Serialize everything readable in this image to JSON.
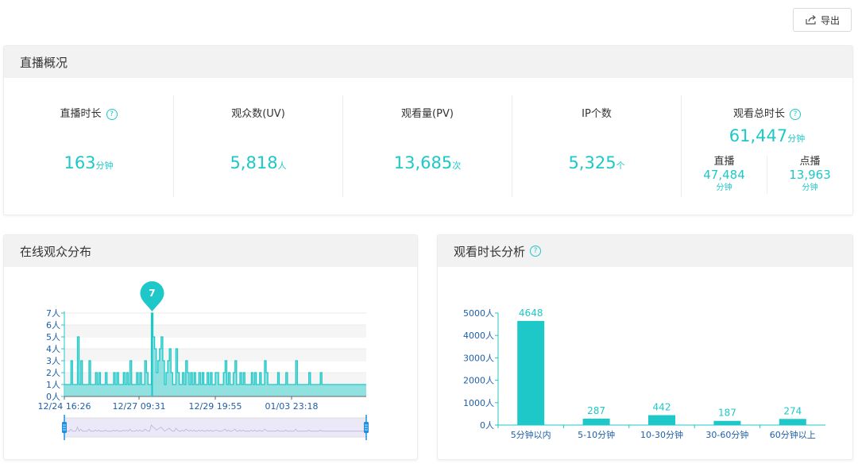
{
  "toolbar": {
    "export_label": "导出",
    "export_icon": "export-icon"
  },
  "overview": {
    "title": "直播概况",
    "stats": [
      {
        "label": "直播时长",
        "value": "163",
        "unit": "分钟",
        "help": true
      },
      {
        "label": "观众数(UV)",
        "value": "5,818",
        "unit": "人",
        "help": false
      },
      {
        "label": "观看量(PV)",
        "value": "13,685",
        "unit": "次",
        "help": false
      },
      {
        "label": "IP个数",
        "value": "5,325",
        "unit": "个",
        "help": false
      }
    ],
    "total": {
      "label": "观看总时长",
      "value": "61,447",
      "unit": "分钟",
      "live": {
        "label": "直播",
        "value": "47,484",
        "unit": "分钟"
      },
      "vod": {
        "label": "点播",
        "value": "13,963",
        "unit": "分钟"
      }
    }
  },
  "online": {
    "title": "在线观众分布",
    "help": false
  },
  "duration": {
    "title": "观看时长分析",
    "help": true
  },
  "colors": {
    "accent": "#1ec8c8",
    "header_bg": "#f2f2f2",
    "slider": "#1e90e0"
  },
  "chart_data": [
    {
      "type": "area",
      "title": "在线观众分布",
      "y_ticks": [
        "0人",
        "1人",
        "2人",
        "3人",
        "4人",
        "5人",
        "6人",
        "7人"
      ],
      "ylim": [
        0,
        7
      ],
      "x_ticks": [
        "12/24 16:26",
        "12/27 09:31",
        "12/29 19:55",
        "01/03 23:18"
      ],
      "peak_label": "7",
      "values": [
        1,
        1,
        1,
        1,
        3,
        1,
        1,
        1,
        5,
        1,
        3,
        1,
        1,
        1,
        1,
        3,
        1,
        1,
        1,
        2,
        1,
        2,
        1,
        1,
        1,
        2,
        1,
        1,
        1,
        1,
        2,
        1,
        2,
        1,
        1,
        1,
        2,
        1,
        2,
        1,
        3,
        1,
        1,
        1,
        2,
        1,
        2,
        1,
        1,
        3,
        2,
        1,
        1,
        7,
        5,
        4,
        2,
        3,
        4,
        5,
        3,
        1,
        2,
        3,
        4,
        2,
        1,
        1,
        4,
        2,
        1,
        1,
        2,
        1,
        3,
        2,
        1,
        2,
        1,
        2,
        1,
        1,
        2,
        1,
        2,
        1,
        1,
        2,
        1,
        2,
        1,
        1,
        2,
        2,
        1,
        1,
        1,
        2,
        3,
        1,
        2,
        1,
        1,
        2,
        3,
        1,
        1,
        2,
        1,
        2,
        1,
        1,
        1,
        1,
        2,
        1,
        2,
        1,
        1,
        2,
        1,
        1,
        3,
        2,
        1,
        1,
        1,
        1,
        1,
        1,
        2,
        1,
        1,
        1,
        1,
        2,
        1,
        1,
        1,
        1,
        1,
        3,
        1,
        1,
        1,
        1,
        1,
        1,
        1,
        2,
        1,
        1,
        1,
        1,
        1,
        1,
        2,
        1,
        1,
        1,
        1,
        1,
        1,
        1,
        1,
        1,
        1,
        1,
        1,
        1,
        1,
        1,
        1,
        1,
        1,
        1,
        1,
        1,
        1,
        1,
        1,
        1,
        1,
        1,
        1
      ],
      "grid": true
    },
    {
      "type": "bar",
      "title": "观看时长分析",
      "categories": [
        "5分钟以内",
        "5-10分钟",
        "10-30分钟",
        "30-60分钟",
        "60分钟以上"
      ],
      "values": [
        4648,
        287,
        442,
        187,
        274
      ],
      "y_ticks": [
        "0人",
        "1000人",
        "2000人",
        "3000人",
        "4000人",
        "5000人"
      ],
      "ylim": [
        0,
        5000
      ]
    }
  ]
}
